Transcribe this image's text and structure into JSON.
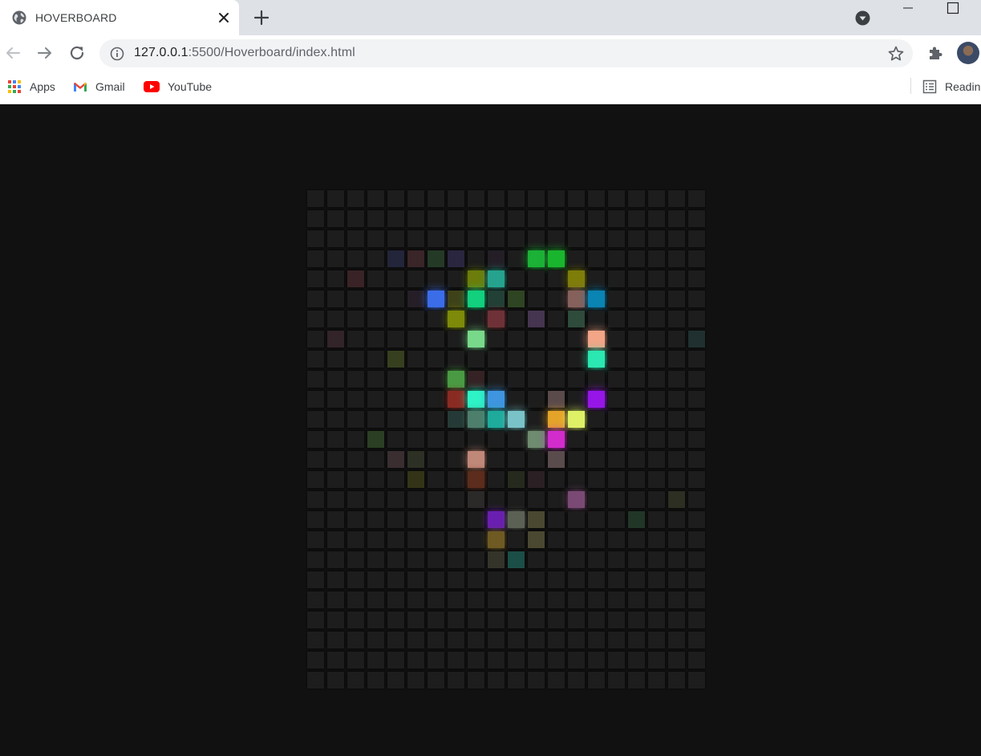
{
  "browser": {
    "tab_title": "HOVERBOARD",
    "url_host": "127.0.0.1",
    "url_path": ":5500/Hoverboard/index.html",
    "bookmarks": [
      {
        "label": "Apps",
        "icon": "apps-grid-icon"
      },
      {
        "label": "Gmail",
        "icon": "gmail-icon"
      },
      {
        "label": "YouTube",
        "icon": "youtube-icon"
      }
    ],
    "reading_list_label": "Readin"
  },
  "board": {
    "rows": 25,
    "cols": 20,
    "default_color": "#1d1d1d",
    "lit_squares": [
      {
        "r": 3,
        "c": 4,
        "color": "#23253a",
        "strength": 0.25
      },
      {
        "r": 3,
        "c": 5,
        "color": "#3a2528",
        "strength": 0.25
      },
      {
        "r": 3,
        "c": 6,
        "color": "#243a27",
        "strength": 0.25
      },
      {
        "r": 3,
        "c": 7,
        "color": "#2a2640",
        "strength": 0.25
      },
      {
        "r": 3,
        "c": 9,
        "color": "#241e27",
        "strength": 0.2
      },
      {
        "r": 3,
        "c": 11,
        "color": "#1cb137",
        "strength": 1
      },
      {
        "r": 3,
        "c": 12,
        "color": "#1ab52e",
        "strength": 1
      },
      {
        "r": 4,
        "c": 2,
        "color": "#3a2326",
        "strength": 0.3
      },
      {
        "r": 4,
        "c": 8,
        "color": "#6c7d0b",
        "strength": 0.8
      },
      {
        "r": 4,
        "c": 9,
        "color": "#26a38e",
        "strength": 0.9
      },
      {
        "r": 4,
        "c": 13,
        "color": "#7e7d0a",
        "strength": 0.8
      },
      {
        "r": 5,
        "c": 5,
        "color": "#251e27",
        "strength": 0.2
      },
      {
        "r": 5,
        "c": 6,
        "color": "#3b6de9",
        "strength": 1
      },
      {
        "r": 5,
        "c": 7,
        "color": "#3f4219",
        "strength": 0.4
      },
      {
        "r": 5,
        "c": 8,
        "color": "#12d07d",
        "strength": 1
      },
      {
        "r": 5,
        "c": 9,
        "color": "#234036",
        "strength": 0.4
      },
      {
        "r": 5,
        "c": 10,
        "color": "#2f4423",
        "strength": 0.4
      },
      {
        "r": 5,
        "c": 13,
        "color": "#86615b",
        "strength": 0.8
      },
      {
        "r": 5,
        "c": 14,
        "color": "#0a84b2",
        "strength": 1
      },
      {
        "r": 6,
        "c": 7,
        "color": "#7d8a0a",
        "strength": 0.8
      },
      {
        "r": 6,
        "c": 9,
        "color": "#6e3137",
        "strength": 0.7
      },
      {
        "r": 6,
        "c": 11,
        "color": "#463550",
        "strength": 0.4
      },
      {
        "r": 6,
        "c": 13,
        "color": "#2e4b3c",
        "strength": 0.4
      },
      {
        "r": 7,
        "c": 1,
        "color": "#33242a",
        "strength": 0.2
      },
      {
        "r": 7,
        "c": 8,
        "color": "#79d98b",
        "strength": 1
      },
      {
        "r": 7,
        "c": 14,
        "color": "#f2a587",
        "strength": 1
      },
      {
        "r": 7,
        "c": 19,
        "color": "#203030",
        "strength": 0.2
      },
      {
        "r": 8,
        "c": 4,
        "color": "#36401f",
        "strength": 0.3
      },
      {
        "r": 8,
        "c": 14,
        "color": "#2be7b1",
        "strength": 1
      },
      {
        "r": 9,
        "c": 7,
        "color": "#4a9a43",
        "strength": 0.8
      },
      {
        "r": 9,
        "c": 8,
        "color": "#352224",
        "strength": 0.3
      },
      {
        "r": 10,
        "c": 7,
        "color": "#8a2b23",
        "strength": 0.7
      },
      {
        "r": 10,
        "c": 8,
        "color": "#2ef3c6",
        "strength": 1
      },
      {
        "r": 10,
        "c": 9,
        "color": "#3f95df",
        "strength": 1
      },
      {
        "r": 10,
        "c": 12,
        "color": "#5a4a4a",
        "strength": 0.5
      },
      {
        "r": 10,
        "c": 14,
        "color": "#9616e7",
        "strength": 1
      },
      {
        "r": 11,
        "c": 7,
        "color": "#253a36",
        "strength": 0.3
      },
      {
        "r": 11,
        "c": 8,
        "color": "#4e7f6c",
        "strength": 0.7
      },
      {
        "r": 11,
        "c": 9,
        "color": "#1eab9c",
        "strength": 0.9
      },
      {
        "r": 11,
        "c": 10,
        "color": "#79c3c8",
        "strength": 1
      },
      {
        "r": 11,
        "c": 12,
        "color": "#e4a42a",
        "strength": 1
      },
      {
        "r": 11,
        "c": 13,
        "color": "#def166",
        "strength": 1
      },
      {
        "r": 12,
        "c": 3,
        "color": "#2a3f23",
        "strength": 0.3
      },
      {
        "r": 12,
        "c": 11,
        "color": "#6f8b70",
        "strength": 0.7
      },
      {
        "r": 12,
        "c": 12,
        "color": "#d22ccd",
        "strength": 1
      },
      {
        "r": 13,
        "c": 4,
        "color": "#3a2e31",
        "strength": 0.3
      },
      {
        "r": 13,
        "c": 5,
        "color": "#2d3024",
        "strength": 0.3
      },
      {
        "r": 13,
        "c": 8,
        "color": "#c08878",
        "strength": 0.9
      },
      {
        "r": 13,
        "c": 12,
        "color": "#5a4b4d",
        "strength": 0.5
      },
      {
        "r": 14,
        "c": 5,
        "color": "#333417",
        "strength": 0.3
      },
      {
        "r": 14,
        "c": 8,
        "color": "#5c2c1c",
        "strength": 0.6
      },
      {
        "r": 14,
        "c": 10,
        "color": "#262a1e",
        "strength": 0.2
      },
      {
        "r": 14,
        "c": 11,
        "color": "#2b2024",
        "strength": 0.2
      },
      {
        "r": 15,
        "c": 8,
        "color": "#2c2a29",
        "strength": 0.2
      },
      {
        "r": 15,
        "c": 13,
        "color": "#7a4a74",
        "strength": 0.8
      },
      {
        "r": 15,
        "c": 18,
        "color": "#2c2f22",
        "strength": 0.2
      },
      {
        "r": 16,
        "c": 9,
        "color": "#6a1fb0",
        "strength": 0.9
      },
      {
        "r": 16,
        "c": 10,
        "color": "#5c6155",
        "strength": 0.6
      },
      {
        "r": 16,
        "c": 11,
        "color": "#4a4830",
        "strength": 0.5
      },
      {
        "r": 16,
        "c": 16,
        "color": "#223628",
        "strength": 0.3
      },
      {
        "r": 17,
        "c": 9,
        "color": "#6e5a22",
        "strength": 0.6
      },
      {
        "r": 17,
        "c": 11,
        "color": "#4a4830",
        "strength": 0.5
      },
      {
        "r": 18,
        "c": 9,
        "color": "#34342a",
        "strength": 0.3
      },
      {
        "r": 18,
        "c": 10,
        "color": "#1b4e46",
        "strength": 0.5
      }
    ]
  }
}
